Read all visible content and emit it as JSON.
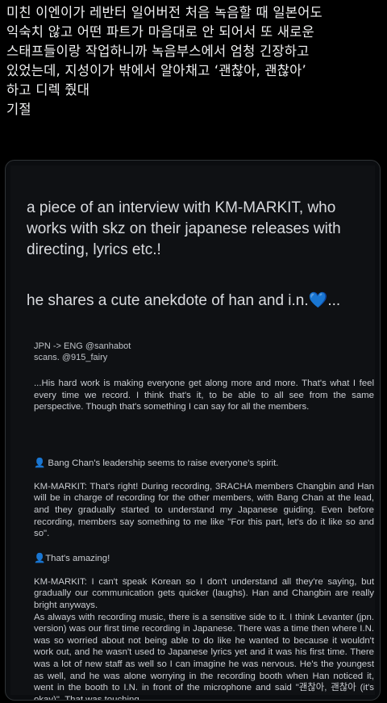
{
  "tweet": {
    "text": "미친 이엔이가 레반터 일어버전 처음 녹음할 때 일본어도\n익숙치 않고 어떤 파트가 마음대로 안 되어서 또 새로운\n스태프들이랑  작업하니까 녹음부스에서 엄청 긴장하고\n있었는데, 지성이가 밖에서 알아채고 ‘괜찮아, 괜찮아’\n하고 디렉 줬대\n기절"
  },
  "card": {
    "intro_line1": "a piece of an interview with KM-MARKIT, who works with skz on their japanese releases with directing, lyrics etc.!",
    "intro_line2": "he shares a cute anekdote of han and i.n.",
    "heart_emoji": "💙",
    "intro_line2_suffix": "...",
    "credit_line1": "JPN -> ENG @sanhabot",
    "credit_line2": "scans. @915_fairy",
    "paragraph1": "...His hard work is making everyone get along more and more. That's what I feel every time we record. I think that's it, to be able to all see from the same perspective. Though that's something I can say for all the members.",
    "paragraph2_q": "Bang Chan's leadership seems to raise everyone's spirit.",
    "paragraph2_a": "KM-MARKIT: That's right! During recording, 3RACHA members Changbin and Han will be in charge of recording for the other members, with Bang Chan at the lead, and they gradually started to understand my Japanese guiding. Even before recording, members say something to me like \"For this part, let's do it like so and so\".",
    "paragraph3_q": "That's amazing!",
    "paragraph3_a": "KM-MARKIT: I can't speak Korean so I don't understand all they're saying, but gradually our communication gets quicker (laughs). Han and Changbin are really bright anyways.\nAs always with recording music, there is a sensitive side to it. I think Levanter (jpn. version) was our first time recording in Japanese. There was a time then where I.N. was so worried about not being able to do like he wanted to because it wouldn't work out, and he wasn't used to Japanese lyrics yet and it was his first time. There was a lot of new staff as well so I can imagine he was nervous. He's the youngest as well, and he was alone worrying in the recording booth when Han noticed it, went in the booth to I.N. in front of the microphone and said \"괜찮아, 괜찮아 (it's okay)\". That was touching."
  },
  "icons": {
    "person": "bust-in-silhouette-icon"
  }
}
